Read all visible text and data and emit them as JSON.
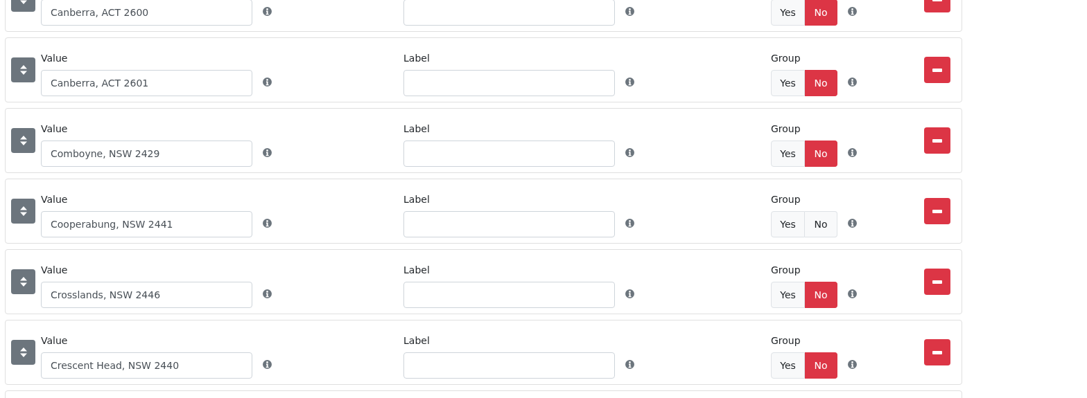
{
  "rows": [
    {
      "kind": "full",
      "value": "Canberra, ACT 2600",
      "label_value": "",
      "group": [
        {
          "label": "Yes",
          "selected": false
        },
        {
          "label": "No",
          "selected": true
        }
      ]
    },
    {
      "kind": "full",
      "value_heading": "Value",
      "label_heading": "Label",
      "group_heading": "Group",
      "value": "Canberra, ACT 2601",
      "group": [
        {
          "label": "Yes",
          "selected": false
        },
        {
          "label": "No",
          "selected": true
        }
      ]
    },
    {
      "kind": "full",
      "value_heading": "Value",
      "label_heading": "Label",
      "group_heading": "Group",
      "value": "Comboyne, NSW 2429",
      "group": [
        {
          "label": "Yes",
          "selected": false
        },
        {
          "label": "No",
          "selected": true
        }
      ]
    },
    {
      "kind": "full",
      "value_heading": "Value",
      "label_heading": "Label",
      "group_heading": "Group",
      "value": "Cooperabung, NSW 2441",
      "group": [
        {
          "label": "Yes",
          "selected": false
        },
        {
          "label": "No",
          "selected": false
        }
      ]
    },
    {
      "kind": "full",
      "value_heading": "Value",
      "label_heading": "Label",
      "group_heading": "Group",
      "value": "Crosslands, NSW 2446",
      "group": [
        {
          "label": "Yes",
          "selected": false
        },
        {
          "label": "No",
          "selected": true
        }
      ]
    },
    {
      "kind": "full",
      "value_heading": "Value",
      "label_heading": "Label",
      "group_heading": "Group",
      "value": "Crescent Head, NSW 2440",
      "group": [
        {
          "label": "Yes",
          "selected": false
        },
        {
          "label": "No",
          "selected": true
        }
      ]
    },
    {
      "kind": "edge"
    }
  ]
}
